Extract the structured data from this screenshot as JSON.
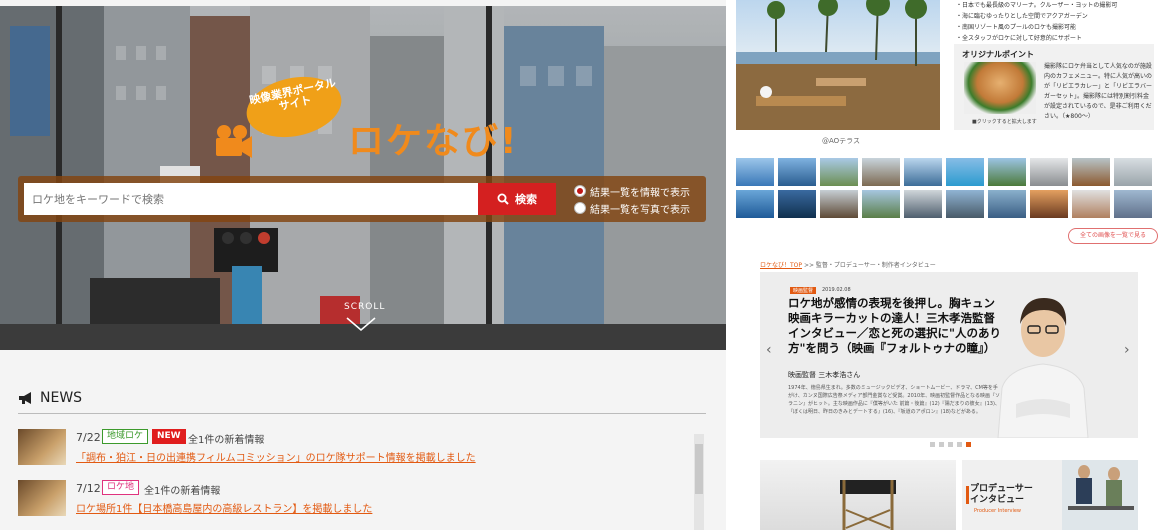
{
  "hero": {
    "bubble_text": "映像業界ポータルサイト",
    "logo_text": "ロケなび!",
    "search_placeholder": "ロケ地をキーワードで検索",
    "search_button": "検索",
    "radio_info": "結果一覧を情報で表示",
    "radio_photo": "結果一覧を写真で表示",
    "scroll_label": "SCROLL"
  },
  "news": {
    "heading": "NEWS",
    "items": [
      {
        "date": "7/22",
        "tag": "地域ロケ",
        "badge": "NEW",
        "meta": "全1件の新着情報",
        "link": "「調布・狛江・日の出連携フィルムコミッション」のロケ隊サポート情報を掲載しました"
      },
      {
        "date": "7/12",
        "tag": "ロケ地",
        "meta": "全1件の新着情報",
        "link": "ロケ場所1件【日本橋高島屋内の高級レストラン】を掲載しました"
      }
    ]
  },
  "location": {
    "bullets": [
      "・日本でも最長級のマリーナ。クルーザー・ヨットの撮影可",
      "・海に臨むゆったりとした空間でアクアガーデン",
      "・南国リゾート風のプールのロケも撮影可能",
      "・全スタッフがロケに対して好意的にサポート"
    ],
    "caption": "@AOテラス",
    "original_title": "オリジナルポイント",
    "original_caption": "■クリックすると拡大します",
    "original_text": "撮影隊にロケ弁当として人気なのが施設内のカフェメニュー。特に人気が高いのが「リビエラカレー」と「リビエラバーガーセット」。撮影隊には特別割引料金が設定されているので、是非ご利用ください。（★800～）",
    "see_all": "全ての画像を一覧で見る"
  },
  "interview": {
    "crumb_home": "ロケなび！TOP",
    "crumb_rest": ">> 監督・プロデューサー・制作者インタビュー",
    "date_tag": "映画監督",
    "date": "2019.02.08",
    "title": "ロケ地が感情の表現を後押し。胸キュン映画キラーカットの達人！三木孝浩監督インタビュー／恋と死の選択に\"人のあり方\"を問う（映画『フォルトゥナの瞳』）",
    "subtitle": "映画監督 三木孝浩さん",
    "description": "1974年、徳島県生まれ。多数のミュージックビデオ、ショートムービー、ドラマ、CM等を手がけ、カンヌ国際広告祭メディア部門金賞など受賞。2010年、映画初監督作品となる映画『ソラニン』がヒット。主な映画作品に『僕等がいた 前篇・後篇』(12)『陽だまりの彼女』(13)、『ぼくは明日、昨日のきみとデートする』(16)、『坂道のアポロン』(18)などがある。",
    "prev": "‹",
    "next": "›"
  },
  "producer_card": {
    "title_line1": "プロデューサー",
    "title_line2": "インタビュー",
    "subtitle": "Producer Interview"
  },
  "colors": {
    "accent_orange": "#e25a12",
    "search_red": "#d42020",
    "tag_green": "#3c9a2c",
    "tag_pink": "#e0337e",
    "logo_orange": "#f08a1c"
  }
}
